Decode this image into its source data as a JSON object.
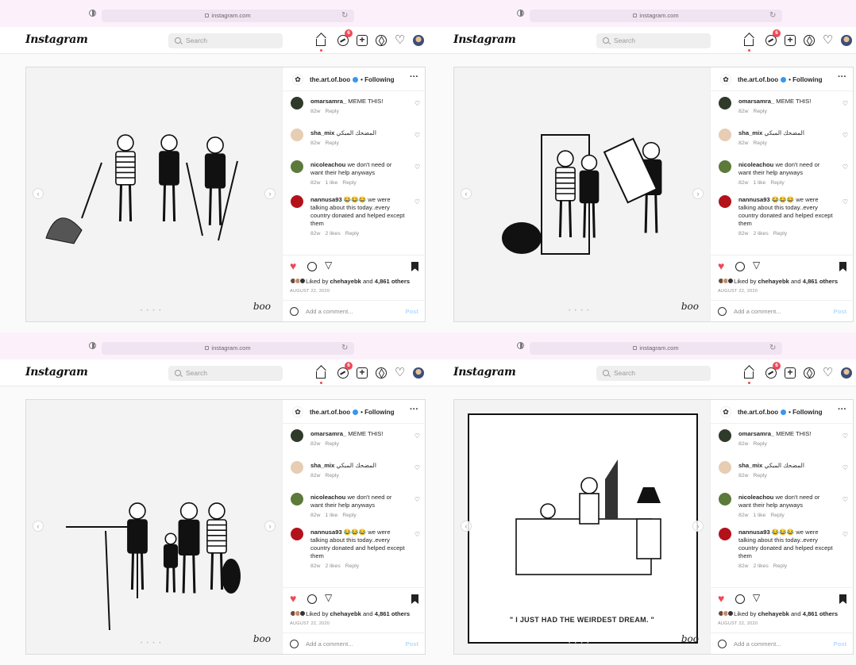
{
  "browser": {
    "url": "instagram.com"
  },
  "instagram": {
    "logo": "Instagram",
    "search_placeholder": "Search",
    "notification_count": "6"
  },
  "post": {
    "account": "the.art.of.boo",
    "dot": "•",
    "follow_status": "Following",
    "more": "···",
    "comments": [
      {
        "user": "omarsamra_",
        "text": "MEME THIS!",
        "time": "82w",
        "likes": "",
        "reply": "Reply"
      },
      {
        "user": "sha_mix",
        "text": "المضحك المبكي",
        "time": "82w",
        "likes": "",
        "reply": "Reply"
      },
      {
        "user": "nicoleachou",
        "text": "we don't need or want their help anyways",
        "time": "82w",
        "likes": "1 like",
        "reply": "Reply"
      },
      {
        "user": "nannusa93",
        "text": "😂😂😂 we were talking about this today..every country donated and helped except them",
        "time": "82w",
        "likes": "2 likes",
        "reply": "Reply"
      }
    ],
    "liked_prefix": "Liked by",
    "liked_user": "chehayebk",
    "liked_and": "and",
    "liked_count": "4,861 others",
    "date": "AUGUST 22, 2020",
    "add_comment_placeholder": "Add a comment...",
    "post_button": "Post",
    "signature": "boo",
    "colors": {
      "like": "#ed4956",
      "verified": "#3897f0",
      "post_button": "#b3dbff"
    }
  },
  "panels": [
    {
      "caption": ""
    },
    {
      "caption": ""
    },
    {
      "caption": ""
    },
    {
      "caption": "\" I JUST HAD THE WEIRDEST DREAM. \""
    }
  ]
}
